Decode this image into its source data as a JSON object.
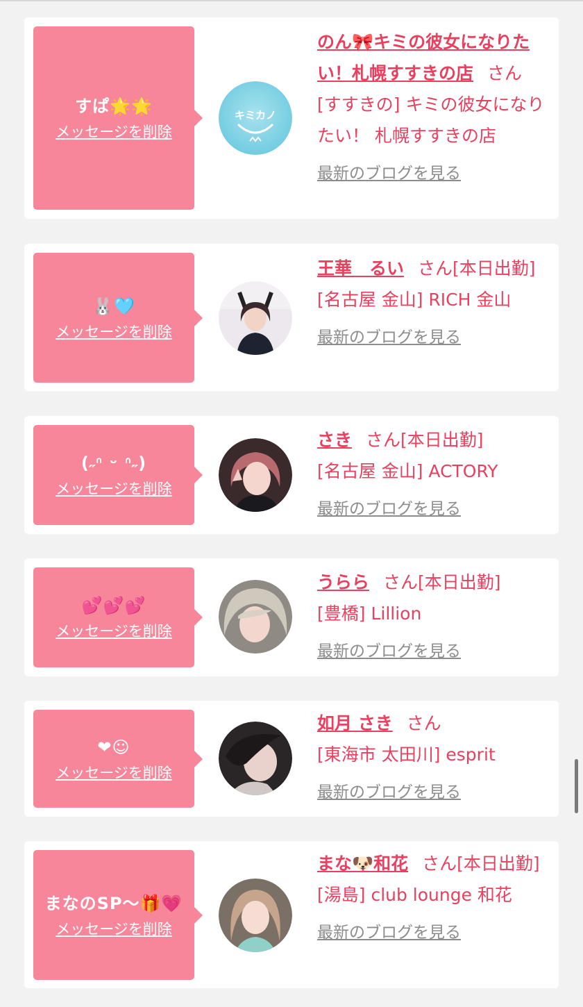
{
  "colors": {
    "accent": "#e8405e",
    "bubble": "#f7869b",
    "card": "#ffffff",
    "background": "#f2f2f2",
    "muted": "#8c8c8c"
  },
  "delete_label": "メッセージを削除",
  "blog_label": "最新のブログを見る",
  "items": [
    {
      "message": "すぱ🌟🌟",
      "name": "のん🎀キミの彼女になりたい！札幌すすきの店",
      "suffix": "さん",
      "shop": "[すすきの] キミの彼女になりたい！ 札幌すすきの店",
      "avatar_icon": "kimikano-logo-icon",
      "avatar_text": "キミカノ"
    },
    {
      "message": "🐰🩵",
      "name": "王華　るい",
      "suffix": "さん[本日出勤]",
      "shop": "[名古屋 金山] RICH 金山",
      "avatar_icon": "profile-photo-icon"
    },
    {
      "message": "(˶ᐢ ᵕ ᐢ˶)",
      "name": "さき",
      "suffix": "さん[本日出勤]",
      "shop": "[名古屋 金山] ACTORY",
      "avatar_icon": "profile-photo-icon"
    },
    {
      "message": "💕💕💕",
      "name": "うらら",
      "suffix": "さん[本日出勤]",
      "shop": "[豊橋] Lillion",
      "avatar_icon": "profile-photo-icon"
    },
    {
      "message": "❤☺",
      "name": "如月 さき",
      "suffix": "さん",
      "shop": "[東海市 太田川] esprit",
      "avatar_icon": "profile-photo-icon"
    },
    {
      "message": "まなのSP〜🎁💗",
      "name": "まな🐶和花",
      "suffix": "さん[本日出勤]",
      "shop": "[湯島] club lounge 和花",
      "avatar_icon": "profile-photo-icon"
    }
  ]
}
